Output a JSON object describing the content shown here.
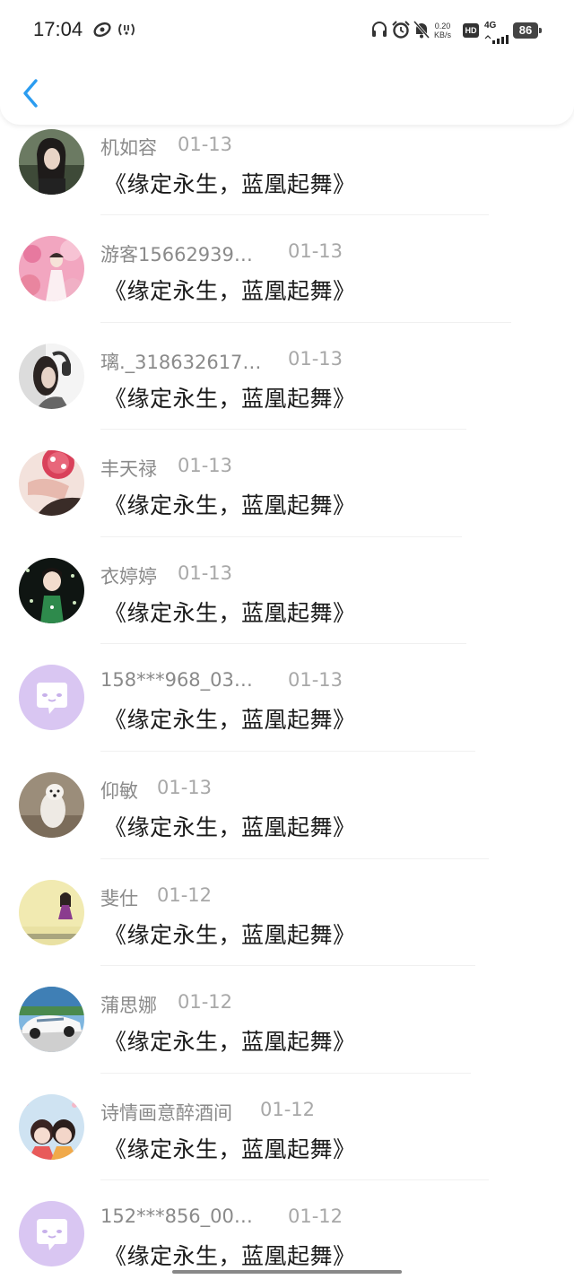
{
  "status_bar": {
    "time": "17:04",
    "net_speed_value": "0.20",
    "net_speed_unit": "KB/s",
    "hd": "HD",
    "network": "4G",
    "battery": "86"
  },
  "messages": [
    {
      "name": "机如容",
      "date": "01-13",
      "message": "《缘定永生，蓝凰起舞》",
      "avatar": "photo-woman"
    },
    {
      "name": "游客15662939…",
      "date": "01-13",
      "message": "《缘定永生，蓝凰起舞》",
      "avatar": "photo-pink"
    },
    {
      "name": "璃._318632617…",
      "date": "01-13",
      "message": "《缘定永生，蓝凰起舞》",
      "avatar": "photo-headphones"
    },
    {
      "name": "丰天禄",
      "date": "01-13",
      "message": "《缘定永生，蓝凰起舞》",
      "avatar": "photo-flowers"
    },
    {
      "name": "衣婷婷",
      "date": "01-13",
      "message": "《缘定永生，蓝凰起舞》",
      "avatar": "photo-child"
    },
    {
      "name": "158***968_03…",
      "date": "01-13",
      "message": "《缘定永生，蓝凰起舞》",
      "avatar": "default-chat"
    },
    {
      "name": "仰敏",
      "date": "01-13",
      "message": "《缘定永生，蓝凰起舞》",
      "avatar": "photo-dog"
    },
    {
      "name": "斐仕",
      "date": "01-12",
      "message": "《缘定永生，蓝凰起舞》",
      "avatar": "photo-yellow"
    },
    {
      "name": "蒲思娜",
      "date": "01-12",
      "message": "《缘定永生，蓝凰起舞》",
      "avatar": "photo-car"
    },
    {
      "name": "诗情画意醉酒间",
      "date": "01-12",
      "message": "《缘定永生，蓝凰起舞》",
      "avatar": "photo-cartoon"
    },
    {
      "name": "152***856_00…",
      "date": "01-12",
      "message": "《缘定永生，蓝凰起舞》",
      "avatar": "default-chat"
    }
  ],
  "colors": {
    "accent": "#2b9cf0",
    "default_avatar": "#d9c6f2"
  }
}
